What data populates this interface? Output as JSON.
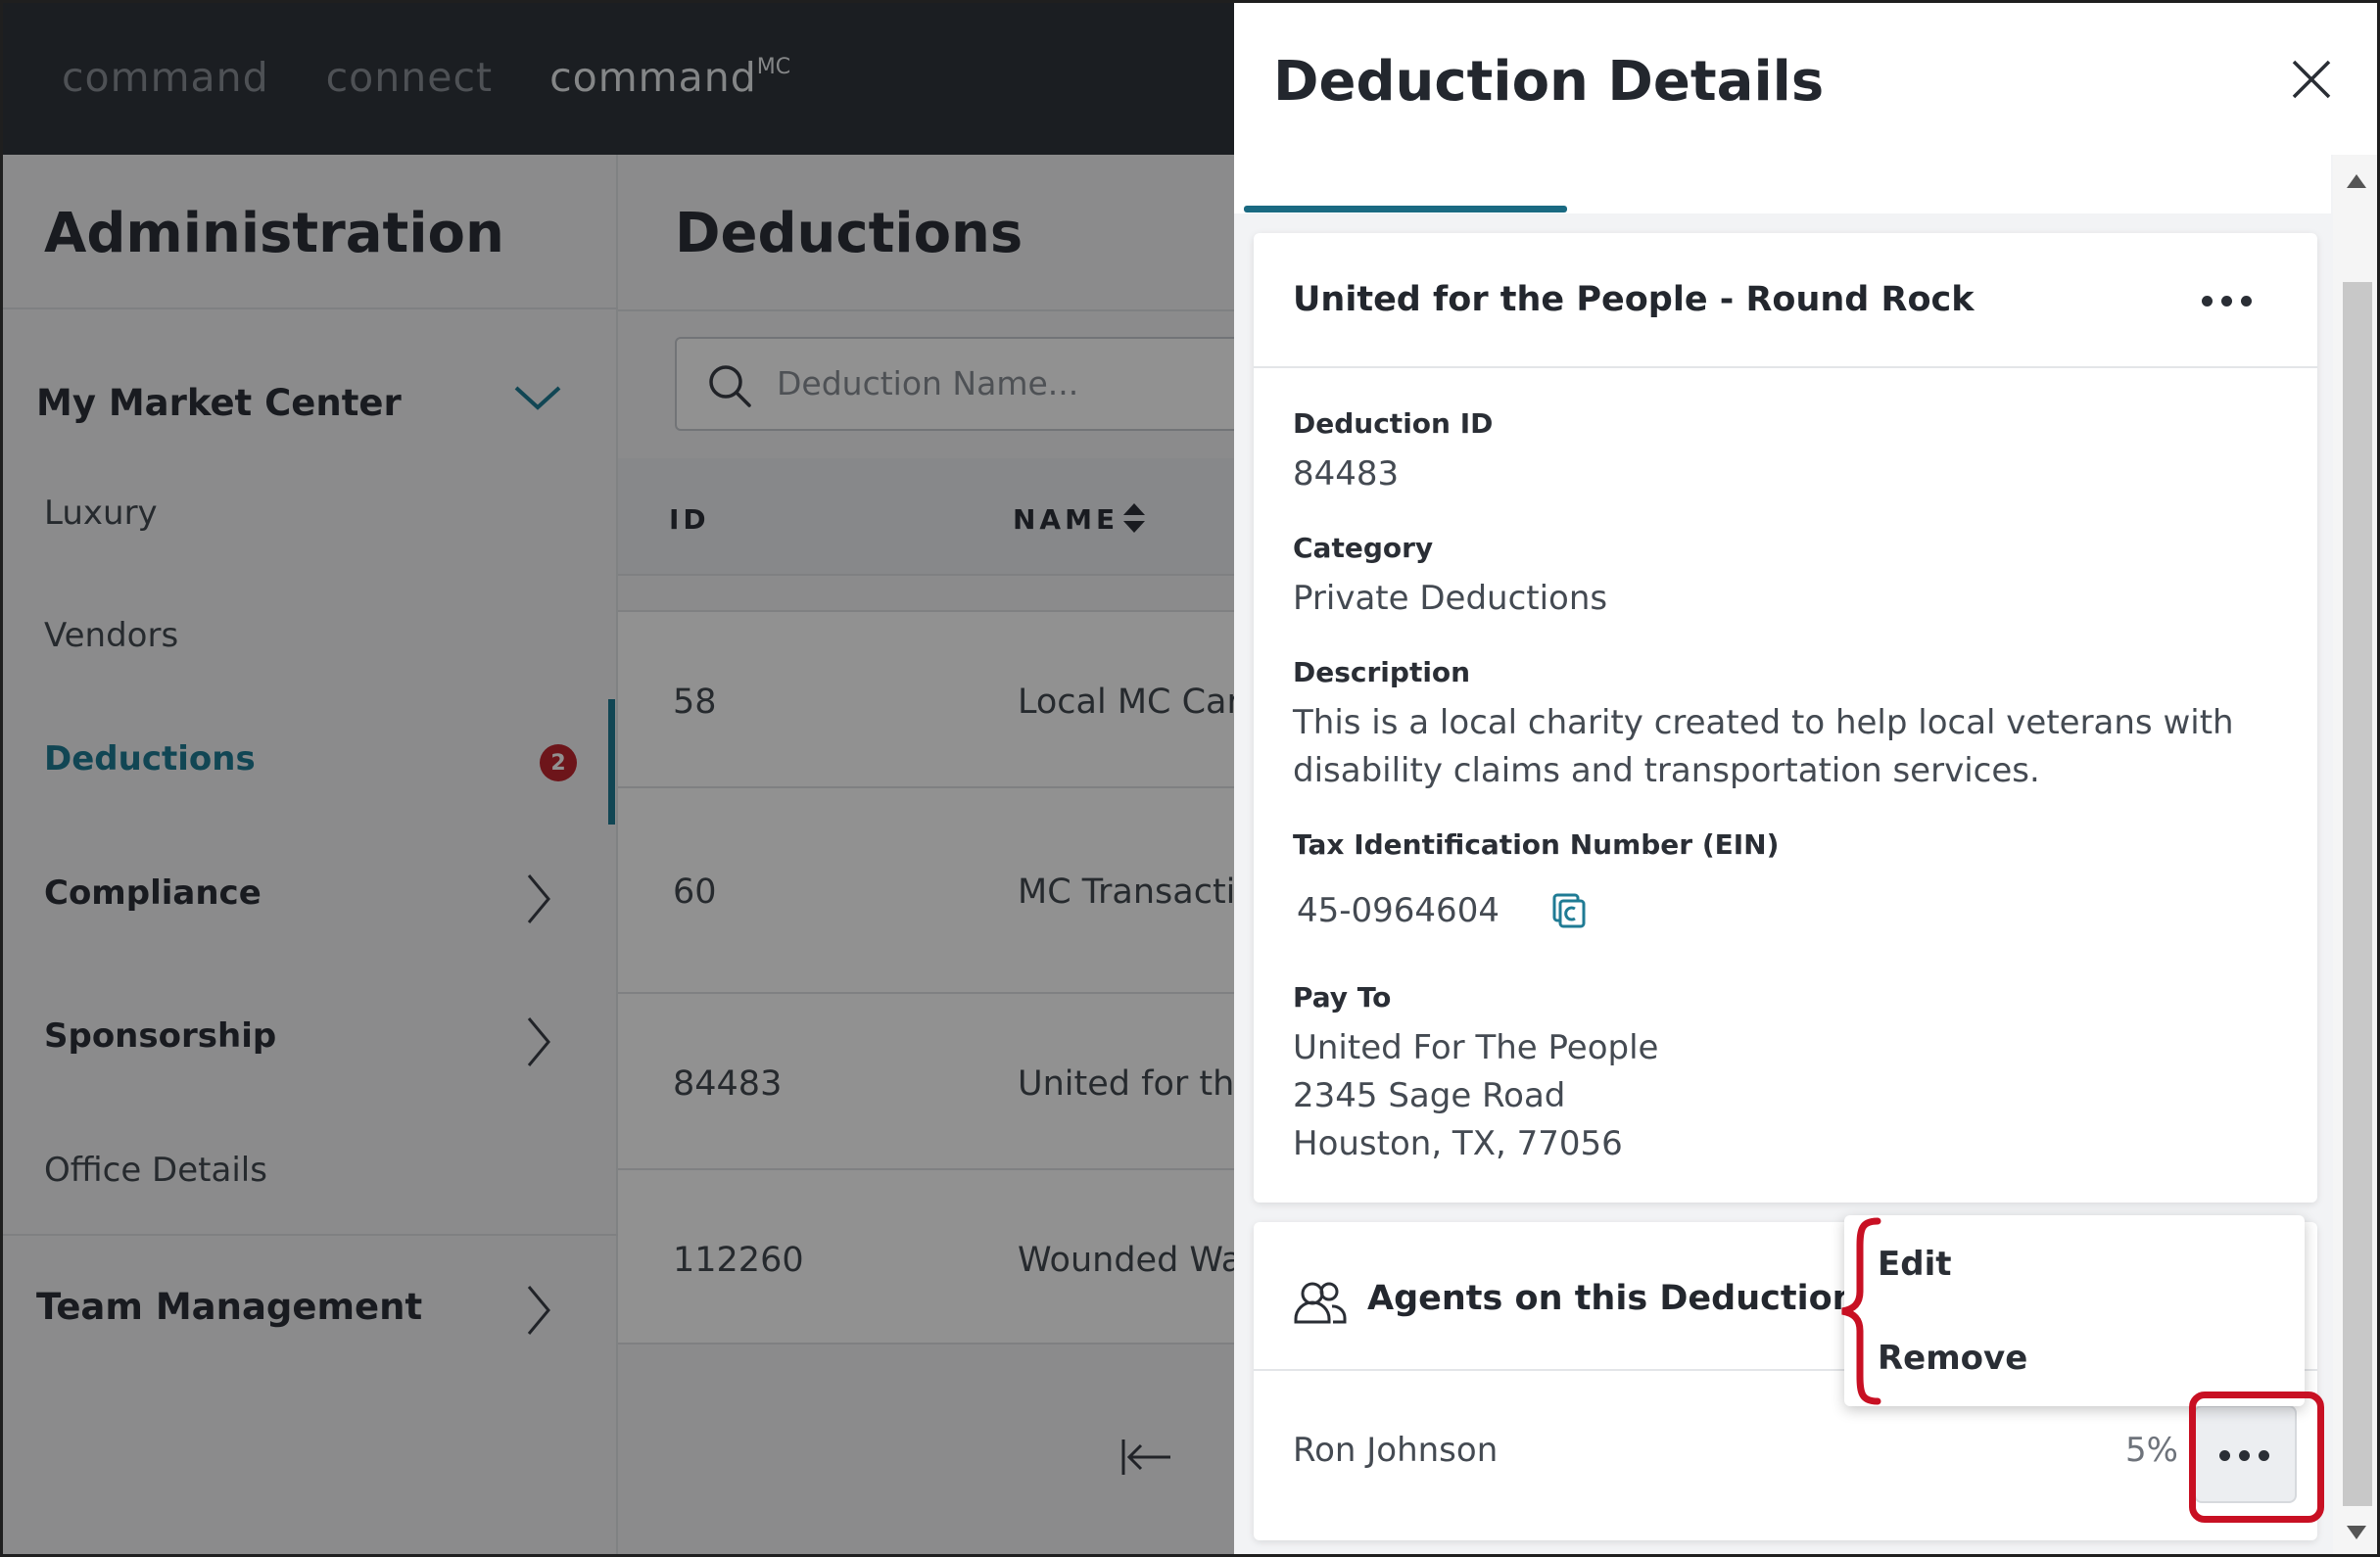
{
  "topnav": {
    "items": [
      "command",
      "connect",
      "command"
    ],
    "active_superscript": "MC"
  },
  "sidebar": {
    "title": "Administration",
    "section": "My Market Center",
    "items": [
      {
        "label": "Luxury"
      },
      {
        "label": "Vendors"
      },
      {
        "label": "Deductions",
        "badge": "2"
      },
      {
        "label": "Compliance"
      },
      {
        "label": "Sponsorship"
      },
      {
        "label": "Office Details"
      }
    ],
    "team": "Team Management"
  },
  "main": {
    "title": "Deductions",
    "search_placeholder": "Deduction Name...",
    "columns": [
      "ID",
      "NAME"
    ],
    "rows": [
      {
        "id": "58",
        "name": "Local MC Care"
      },
      {
        "id": "60",
        "name": "MC Transactio"
      },
      {
        "id": "84483",
        "name": "United for the"
      },
      {
        "id": "112260",
        "name": "Wounded Wa"
      }
    ]
  },
  "panel": {
    "title": "Deduction Details",
    "card_title": "United for the People - Round Rock",
    "fields": {
      "id_label": "Deduction ID",
      "id_value": "84483",
      "category_label": "Category",
      "category_value": "Private Deductions",
      "description_label": "Description",
      "description_value": "This is a local charity created to help local veterans with disability claims and transportation services.",
      "ein_label": "Tax Identification Number (EIN)",
      "ein_value": "45-0964604",
      "payto_label": "Pay To",
      "payto_line1": "United For The People",
      "payto_line2": "2345 Sage Road",
      "payto_line3": "Houston, TX, 77056"
    },
    "agents": {
      "title": "Agents on this Deduction",
      "rows": [
        {
          "name": "Ron Johnson",
          "percent": "5%"
        }
      ]
    },
    "menu": [
      "Edit",
      "Remove"
    ]
  },
  "colors": {
    "accent": "#1f7b94",
    "highlight": "#c81023",
    "topbar": "#30353d"
  }
}
